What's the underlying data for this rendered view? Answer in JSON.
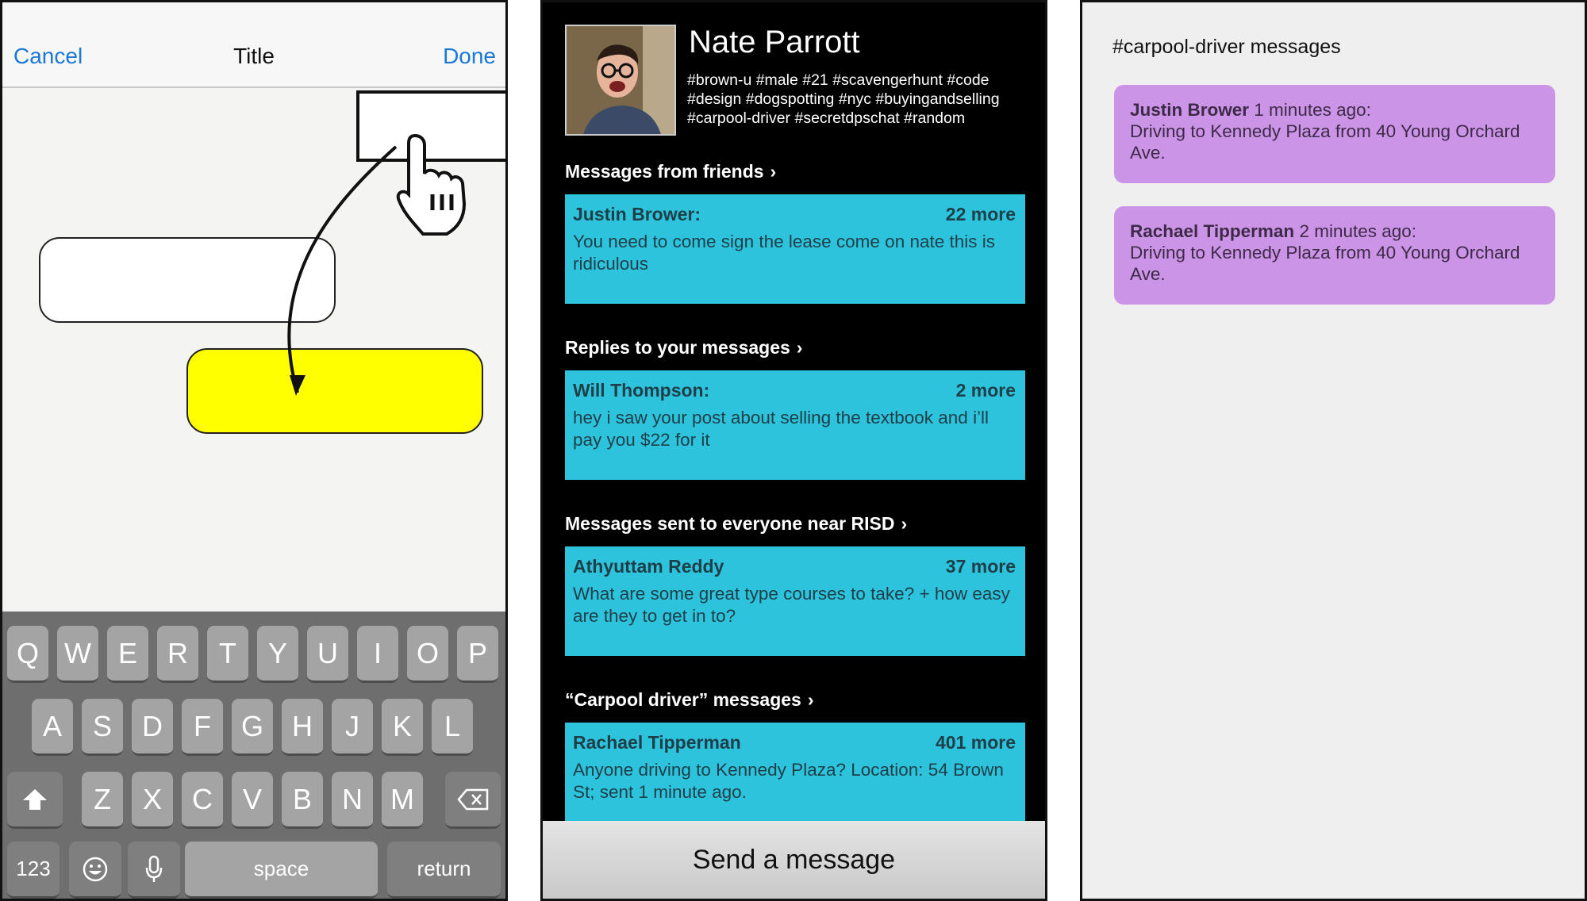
{
  "editor": {
    "nav": {
      "cancel_label": "Cancel",
      "title": "Title",
      "done_label": "Done"
    },
    "keyboard": {
      "row1": [
        "Q",
        "W",
        "E",
        "R",
        "T",
        "Y",
        "U",
        "I",
        "O",
        "P"
      ],
      "row2": [
        "A",
        "S",
        "D",
        "F",
        "G",
        "H",
        "J",
        "K",
        "L"
      ],
      "row3": [
        "Z",
        "X",
        "C",
        "V",
        "B",
        "N",
        "M"
      ],
      "numbers_label": "123",
      "space_label": "space",
      "return_label": "return",
      "shift_icon": "shift-icon",
      "delete_icon": "delete-icon",
      "emoji_icon": "emoji-icon",
      "mic_icon": "microphone-icon"
    },
    "colors": {
      "highlight_bubble": "#ffff00",
      "nav_link": "#1a78d6"
    }
  },
  "feed": {
    "profile": {
      "name": "Nate Parrott",
      "tags": "#brown-u #male #21 #scavengerhunt #code #design #dogspotting #nyc #buyingandselling #carpool-driver #secretdpschat #random"
    },
    "sections": [
      {
        "heading": "Messages from friends",
        "sender": "Justin Brower:",
        "more": "22 more",
        "body": "You need to come sign the lease come on nate this is ridiculous"
      },
      {
        "heading": "Replies to your messages",
        "sender": "Will Thompson:",
        "more": "2 more",
        "body": "hey i saw your post about selling the textbook and i’ll pay you $22 for it"
      },
      {
        "heading": "Messages sent to everyone near RISD",
        "sender": "Athyuttam Reddy",
        "more": "37 more",
        "body": "What are some great type courses to take? + how easy are they to get in to?"
      },
      {
        "heading": "“Carpool driver” messages",
        "sender": "Rachael Tipperman",
        "more": "401 more",
        "body": "Anyone driving to Kennedy Plaza? Location: 54 Brown St; sent 1 minute ago."
      }
    ],
    "send_label": "Send a message",
    "colors": {
      "card": "#2dc3dc",
      "background": "#000000"
    }
  },
  "channel": {
    "title": "#carpool-driver messages",
    "messages": [
      {
        "sender": "Justin Brower",
        "time": "1 minutes ago:",
        "body": "Driving to Kennedy Plaza from 40 Young Orchard Ave."
      },
      {
        "sender": "Rachael Tipperman",
        "time": "2 minutes ago:",
        "body": "Driving to Kennedy Plaza from 40 Young Orchard Ave."
      }
    ],
    "colors": {
      "card": "#cc94e6"
    }
  }
}
